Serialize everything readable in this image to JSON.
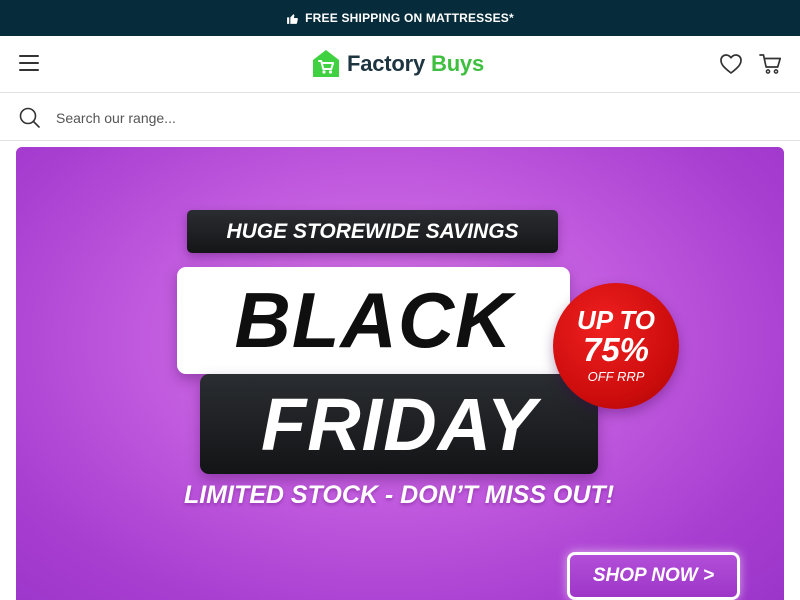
{
  "announcement": {
    "icon": "thumbs-up-icon",
    "text": "FREE SHIPPING ON MATTRESSES*"
  },
  "header": {
    "menu_icon": "hamburger-menu-icon",
    "logo": {
      "word1": "Factory",
      "word2": "Buys",
      "icon": "shopping-cart-house-icon"
    },
    "wishlist_icon": "heart-icon",
    "cart_icon": "cart-icon"
  },
  "search": {
    "icon": "search-icon",
    "placeholder": "Search our range..."
  },
  "banner": {
    "tagline": "HUGE STOREWIDE SAVINGS",
    "headline_line1": "BLACK",
    "headline_line2": "FRIDAY",
    "discount_line1": "UP TO",
    "discount_line2": "75%",
    "discount_line3": "OFF RRP",
    "subheading": "LIMITED STOCK - DON’T MISS OUT!",
    "cta": "SHOP NOW >"
  },
  "colors": {
    "announcement_bg": "#062b3b",
    "logo_dark": "#1d3441",
    "logo_green": "#3fbf3f",
    "banner_purple": "#c45ee0",
    "badge_red": "#cc0c0c"
  }
}
